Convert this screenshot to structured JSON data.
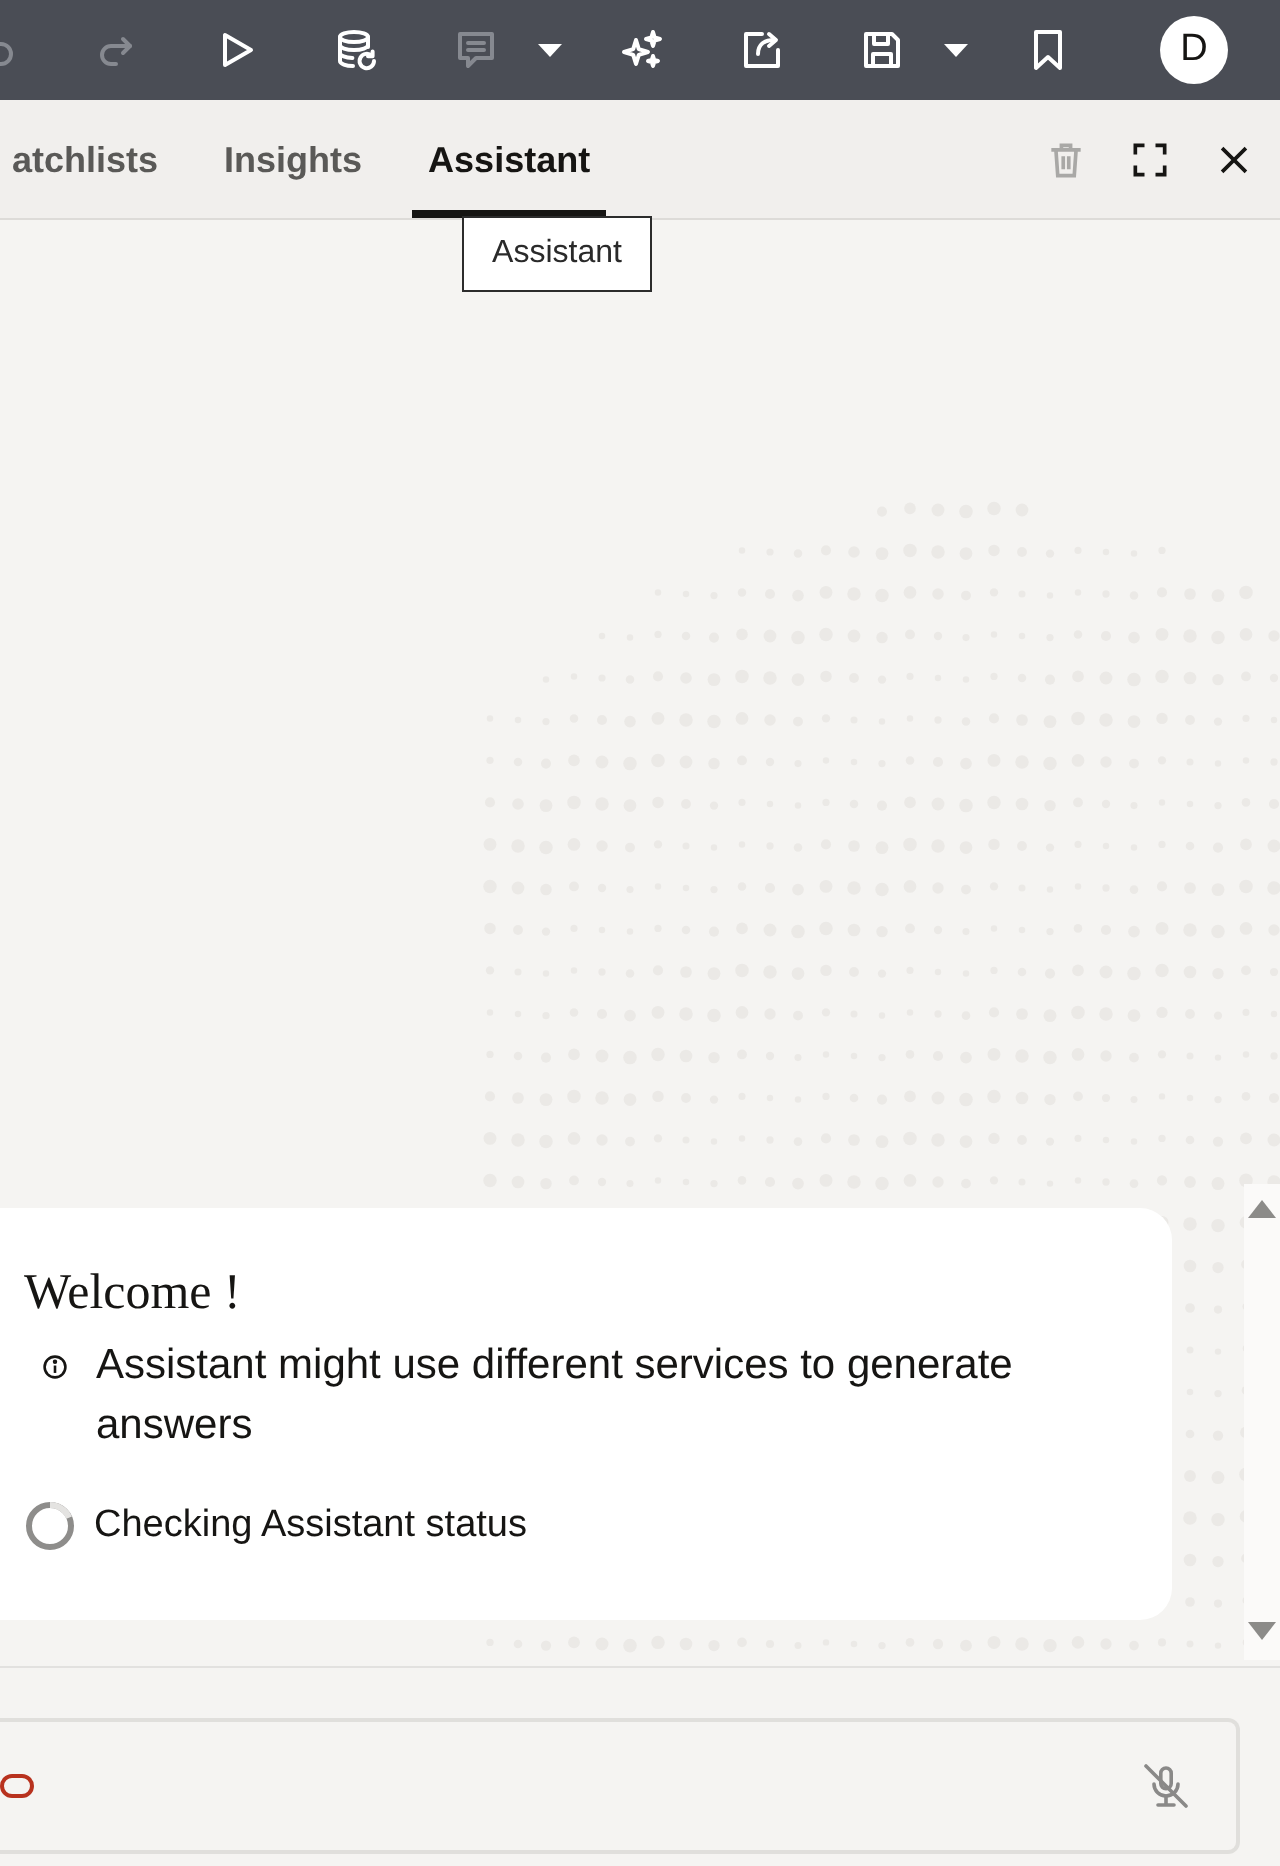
{
  "toolbar": {
    "buttons": [
      {
        "kind": "undo",
        "disabled": true,
        "menu": false
      },
      {
        "kind": "redo",
        "disabled": true,
        "menu": false
      },
      {
        "kind": "run",
        "disabled": false,
        "menu": false
      },
      {
        "kind": "data_refresh",
        "disabled": false,
        "menu": false
      },
      {
        "kind": "comment",
        "disabled": true,
        "menu": true
      },
      {
        "kind": "sparkle",
        "disabled": false,
        "menu": false
      },
      {
        "kind": "export",
        "disabled": false,
        "menu": false
      },
      {
        "kind": "save",
        "disabled": false,
        "menu": true
      },
      {
        "kind": "bookmark",
        "disabled": false,
        "menu": false
      }
    ],
    "avatar": {
      "initial": "D"
    }
  },
  "tabs": [
    {
      "label": "atchlists",
      "selected": false
    },
    {
      "label": "Insights",
      "selected": false
    },
    {
      "label": "Assistant",
      "selected": true
    }
  ],
  "panel_actions": [
    {
      "kind": "delete",
      "disabled": true
    },
    {
      "kind": "fullscreen",
      "disabled": false
    },
    {
      "kind": "close",
      "disabled": false
    }
  ],
  "tooltip": {
    "text": "Assistant"
  },
  "welcome_card": {
    "title": "Welcome !",
    "notice": "Assistant might use different services to generate answers",
    "status": "Checking Assistant status"
  },
  "composer": {
    "mic_muted": true
  }
}
